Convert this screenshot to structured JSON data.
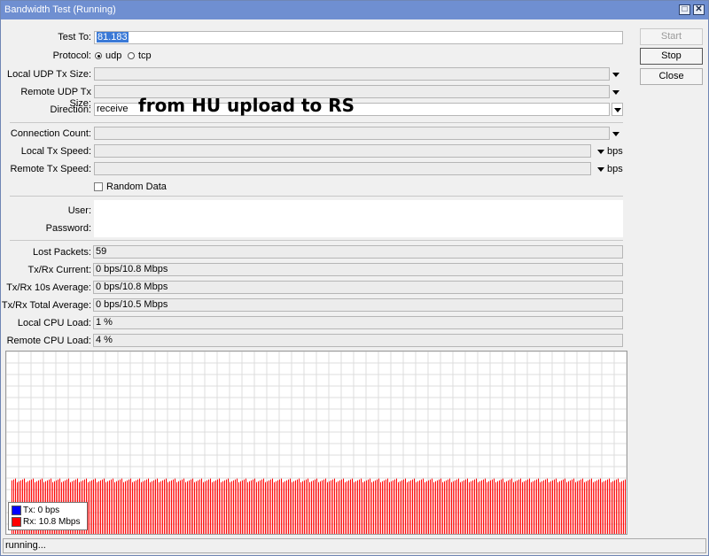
{
  "window": {
    "title": "Bandwidth Test (Running)",
    "minimize_icon": "□",
    "close_icon": "✕"
  },
  "form": {
    "test_to": {
      "label": "Test To:",
      "value": "81.183"
    },
    "protocol": {
      "label": "Protocol:",
      "options": [
        "udp",
        "tcp"
      ],
      "selected": "udp"
    },
    "local_udp_tx_size": {
      "label": "Local UDP Tx Size:",
      "value": ""
    },
    "remote_udp_tx_size": {
      "label": "Remote UDP Tx Size:",
      "value": ""
    },
    "direction": {
      "label": "Direction:",
      "value": "receive"
    },
    "connection_count": {
      "label": "Connection Count:",
      "value": ""
    },
    "local_tx_speed": {
      "label": "Local Tx Speed:",
      "value": "",
      "unit": "bps"
    },
    "remote_tx_speed": {
      "label": "Remote Tx Speed:",
      "value": "",
      "unit": "bps"
    },
    "random_data": {
      "label": "Random Data",
      "checked": false
    },
    "user": {
      "label": "User:",
      "value": ""
    },
    "password": {
      "label": "Password:",
      "value": ""
    }
  },
  "stats": {
    "lost_packets": {
      "label": "Lost Packets:",
      "value": "59"
    },
    "txrx_current": {
      "label": "Tx/Rx Current:",
      "value": "0 bps/10.8 Mbps"
    },
    "txrx_10s_avg": {
      "label": "Tx/Rx 10s Average:",
      "value": "0 bps/10.8 Mbps"
    },
    "txrx_total_avg": {
      "label": "Tx/Rx Total Average:",
      "value": "0 bps/10.5 Mbps"
    },
    "local_cpu": {
      "label": "Local CPU Load:",
      "value": "1 %"
    },
    "remote_cpu": {
      "label": "Remote CPU Load:",
      "value": "4 %"
    }
  },
  "buttons": {
    "start": "Start",
    "stop": "Stop",
    "close": "Close"
  },
  "annotation": "from HU upload to RS",
  "graph": {
    "tx_color": "#0000ff",
    "rx_color": "#ff0000",
    "legend": {
      "tx": "Tx:  0 bps",
      "rx": "Rx:  10.8 Mbps"
    },
    "rx_level": 0.3
  },
  "status": {
    "text": "running..."
  }
}
